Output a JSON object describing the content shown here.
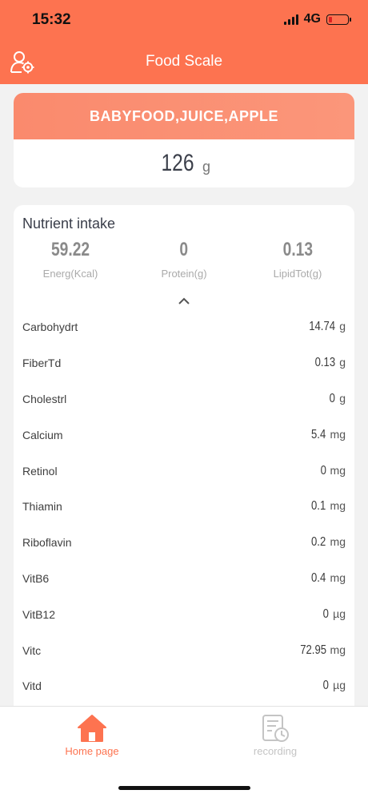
{
  "status": {
    "time": "15:32",
    "network": "4G"
  },
  "header": {
    "title": "Food Scale",
    "user_settings_icon": "user-settings-icon"
  },
  "food": {
    "name": "BABYFOOD,JUICE,APPLE",
    "weight": "126",
    "unit": "g"
  },
  "nutrients": {
    "title": "Nutrient intake",
    "summary": [
      {
        "value": "59.22",
        "label": "Energ(Kcal)"
      },
      {
        "value": "0",
        "label": "Protein(g)"
      },
      {
        "value": "0.13",
        "label": "LipidTot(g)"
      }
    ],
    "rows": [
      {
        "label": "Carbohydrt",
        "value": "14.74",
        "unit": "g"
      },
      {
        "label": "FiberTd",
        "value": "0.13",
        "unit": "g"
      },
      {
        "label": "Cholestrl",
        "value": "0",
        "unit": "g"
      },
      {
        "label": "Calcium",
        "value": "5.4",
        "unit": "mg"
      },
      {
        "label": "Retinol",
        "value": "0",
        "unit": "mg"
      },
      {
        "label": "Thiamin",
        "value": "0.1",
        "unit": "mg"
      },
      {
        "label": "Riboflavin",
        "value": "0.2",
        "unit": "mg"
      },
      {
        "label": "VitB6",
        "value": "0.4",
        "unit": "mg"
      },
      {
        "label": "VitB12",
        "value": "0",
        "unit": "µg"
      },
      {
        "label": "Vitc",
        "value": "72.95",
        "unit": "mg"
      },
      {
        "label": "Vitd",
        "value": "0",
        "unit": "µg"
      }
    ]
  },
  "tabs": [
    {
      "label": "Home page",
      "icon": "home-icon",
      "active": true
    },
    {
      "label": "recording",
      "icon": "recording-icon",
      "active": false
    }
  ],
  "colors": {
    "accent": "#fd7350",
    "food_bar": "#fa8a6d"
  }
}
